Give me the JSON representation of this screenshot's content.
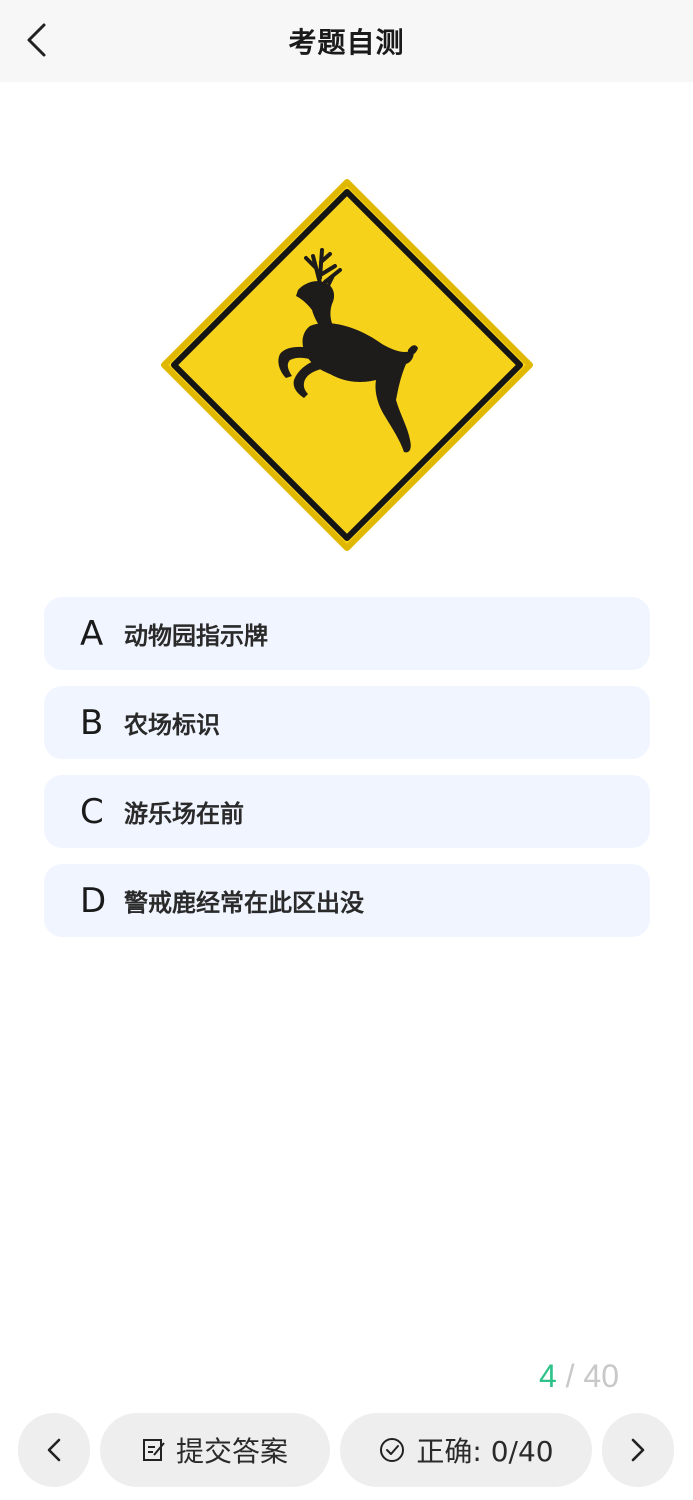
{
  "header": {
    "title": "考题自测",
    "back_icon": "chevron-left-icon"
  },
  "sign": {
    "type": "deer-crossing-warning-sign",
    "fill_color": "#f6d21a",
    "border_color": "#111111"
  },
  "options": [
    {
      "letter": "A",
      "text": "动物园指示牌"
    },
    {
      "letter": "B",
      "text": "农场标识"
    },
    {
      "letter": "C",
      "text": "游乐场在前"
    },
    {
      "letter": "D",
      "text": "警戒鹿经常在此区出没"
    }
  ],
  "progress": {
    "current": "4",
    "separator": "/",
    "total": "40"
  },
  "bottom": {
    "prev_icon": "chevron-left-icon",
    "submit_icon": "edit-icon",
    "submit_label": "提交答案",
    "correct_icon": "check-circle-icon",
    "correct_label": "正确: 0/40",
    "next_icon": "chevron-right-icon"
  },
  "colors": {
    "accent_green": "#2ec28a",
    "option_bg": "#f0f5ff",
    "pill_bg": "#eeeeee"
  }
}
